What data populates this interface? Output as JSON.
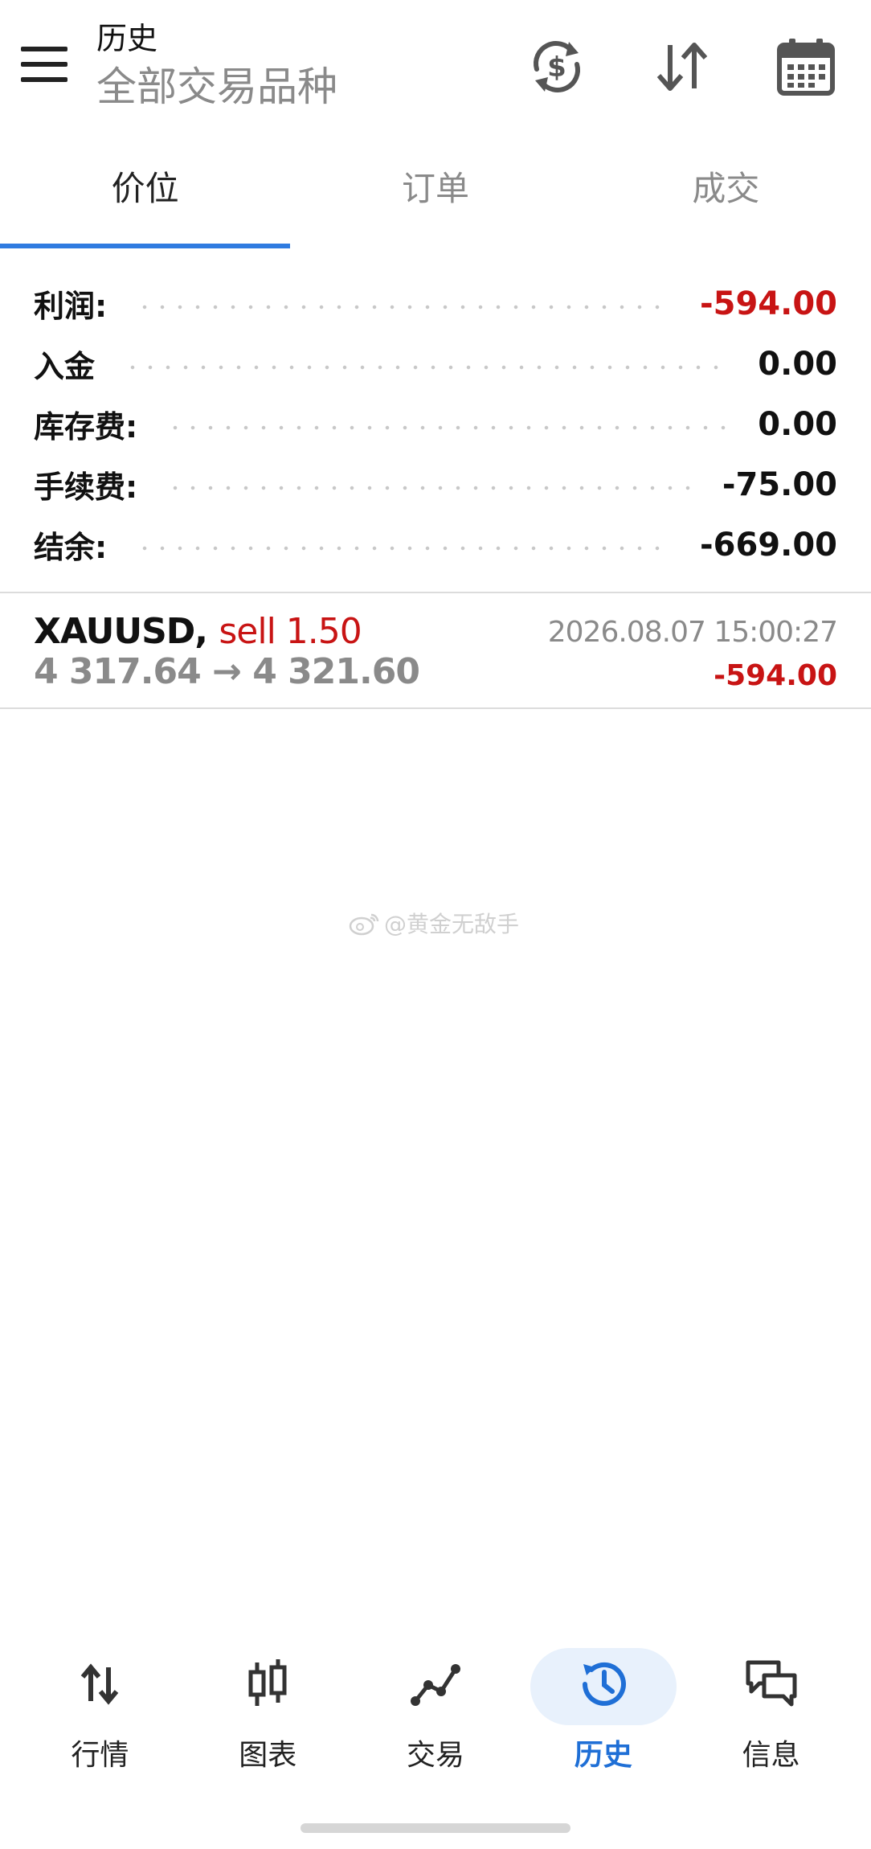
{
  "header": {
    "title": "历史",
    "subtitle": "全部交易品种",
    "icons": [
      "menu-icon",
      "currency-refresh-icon",
      "sort-icon",
      "calendar-icon"
    ]
  },
  "tabs": [
    {
      "label": "价位",
      "active": true
    },
    {
      "label": "订单",
      "active": false
    },
    {
      "label": "成交",
      "active": false
    }
  ],
  "summary": [
    {
      "label": "利润:",
      "value": "-594.00",
      "color": "#c81414"
    },
    {
      "label": "入金",
      "value": "0.00",
      "color": "#111111"
    },
    {
      "label": "库存费:",
      "value": "0.00",
      "color": "#111111"
    },
    {
      "label": "手续费:",
      "value": "-75.00",
      "color": "#111111"
    },
    {
      "label": "结余:",
      "value": "-669.00",
      "color": "#111111"
    }
  ],
  "deal": {
    "symbol": "XAUUSD,",
    "side": "sell 1.50",
    "prices": "4 317.64 → 4 321.60",
    "time": "2026.08.07 15:00:27",
    "profit": "-594.00"
  },
  "watermark": {
    "text": "@黄金无敌手"
  },
  "bottom_nav": [
    {
      "label": "行情",
      "icon": "quotes-icon",
      "active": false
    },
    {
      "label": "图表",
      "icon": "chart-icon",
      "active": false
    },
    {
      "label": "交易",
      "icon": "trade-icon",
      "active": false
    },
    {
      "label": "历史",
      "icon": "history-icon",
      "active": true
    },
    {
      "label": "信息",
      "icon": "messages-icon",
      "active": false
    }
  ],
  "colors": {
    "accent": "#2f7be0",
    "loss": "#c81414",
    "active_nav": "#1f6fd6"
  }
}
